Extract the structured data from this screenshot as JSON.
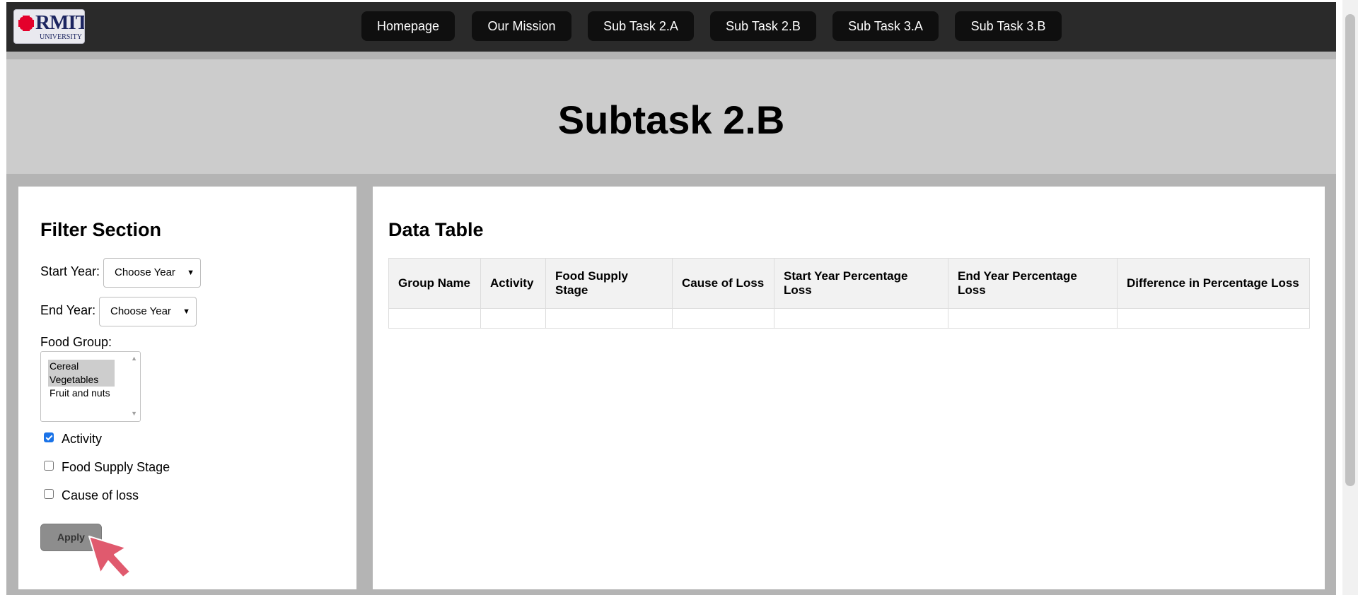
{
  "logo": {
    "word": "RMIT",
    "sub": "UNIVERSITY"
  },
  "nav": {
    "items": [
      {
        "label": "Homepage"
      },
      {
        "label": "Our Mission"
      },
      {
        "label": "Sub Task 2.A"
      },
      {
        "label": "Sub Task 2.B"
      },
      {
        "label": "Sub Task 3.A"
      },
      {
        "label": "Sub Task 3.B"
      }
    ]
  },
  "page": {
    "title": "Subtask 2.B"
  },
  "filter": {
    "heading": "Filter Section",
    "start_year": {
      "label": "Start Year:",
      "value": "Choose Year"
    },
    "end_year": {
      "label": "End Year:",
      "value": "Choose Year"
    },
    "food_group": {
      "label": "Food Group:",
      "options": [
        {
          "label": "Cereal",
          "selected": true
        },
        {
          "label": "Vegetables",
          "selected": true
        },
        {
          "label": "Fruit and nuts",
          "selected": false
        }
      ]
    },
    "checkboxes": [
      {
        "label": "Activity",
        "checked": true
      },
      {
        "label": "Food Supply Stage",
        "checked": false
      },
      {
        "label": "Cause of loss",
        "checked": false
      }
    ],
    "apply_label": "Apply"
  },
  "table": {
    "heading": "Data Table",
    "columns": [
      "Group Name",
      "Activity",
      "Food Supply Stage",
      "Cause of Loss",
      "Start Year Percentage Loss",
      "End Year Percentage Loss",
      "Difference in Percentage Loss"
    ],
    "rows": [
      [
        "",
        "",
        "",
        "",
        "",
        "",
        ""
      ]
    ]
  },
  "icons": {
    "logo": "rmit-pixel-logo",
    "cursor": "pointer-arrow-icon",
    "dropdown": "chevron-down-icon"
  },
  "colors": {
    "navbar": "#2a2a2a",
    "nav_button": "#0f0f0f",
    "banner": "#cccccc",
    "page_background": "#b4b4b4",
    "cursor": "#e05a6e"
  }
}
